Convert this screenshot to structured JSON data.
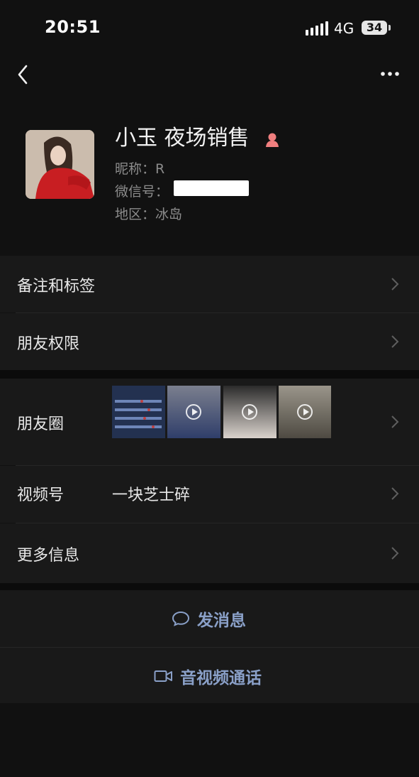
{
  "status_bar": {
    "time": "20:51",
    "network": "4G",
    "battery": "34"
  },
  "nav": {
    "back_icon": "chevron-left-icon",
    "more_icon": "ellipsis-icon"
  },
  "profile": {
    "name": "小玉 夜场销售",
    "gender_icon": "female-icon",
    "nickname_label": "昵称：",
    "nickname": "R",
    "wechat_id_label": "微信号：",
    "region_label": "地区：",
    "region": "冰岛"
  },
  "menu": {
    "remarks_tags": "备注和标签",
    "friend_permissions": "朋友权限",
    "moments": "朋友圈",
    "channels_label": "视频号",
    "channels_value": "一块芝士碎",
    "more_info": "更多信息"
  },
  "actions": {
    "send_message": "发消息",
    "av_call": "音视频通话"
  },
  "colors": {
    "background": "#111111",
    "row_background": "#191919",
    "action_text": "#8aa0c8",
    "secondary_text": "#8c8c8c",
    "gender_icon": "#f07f7f"
  }
}
